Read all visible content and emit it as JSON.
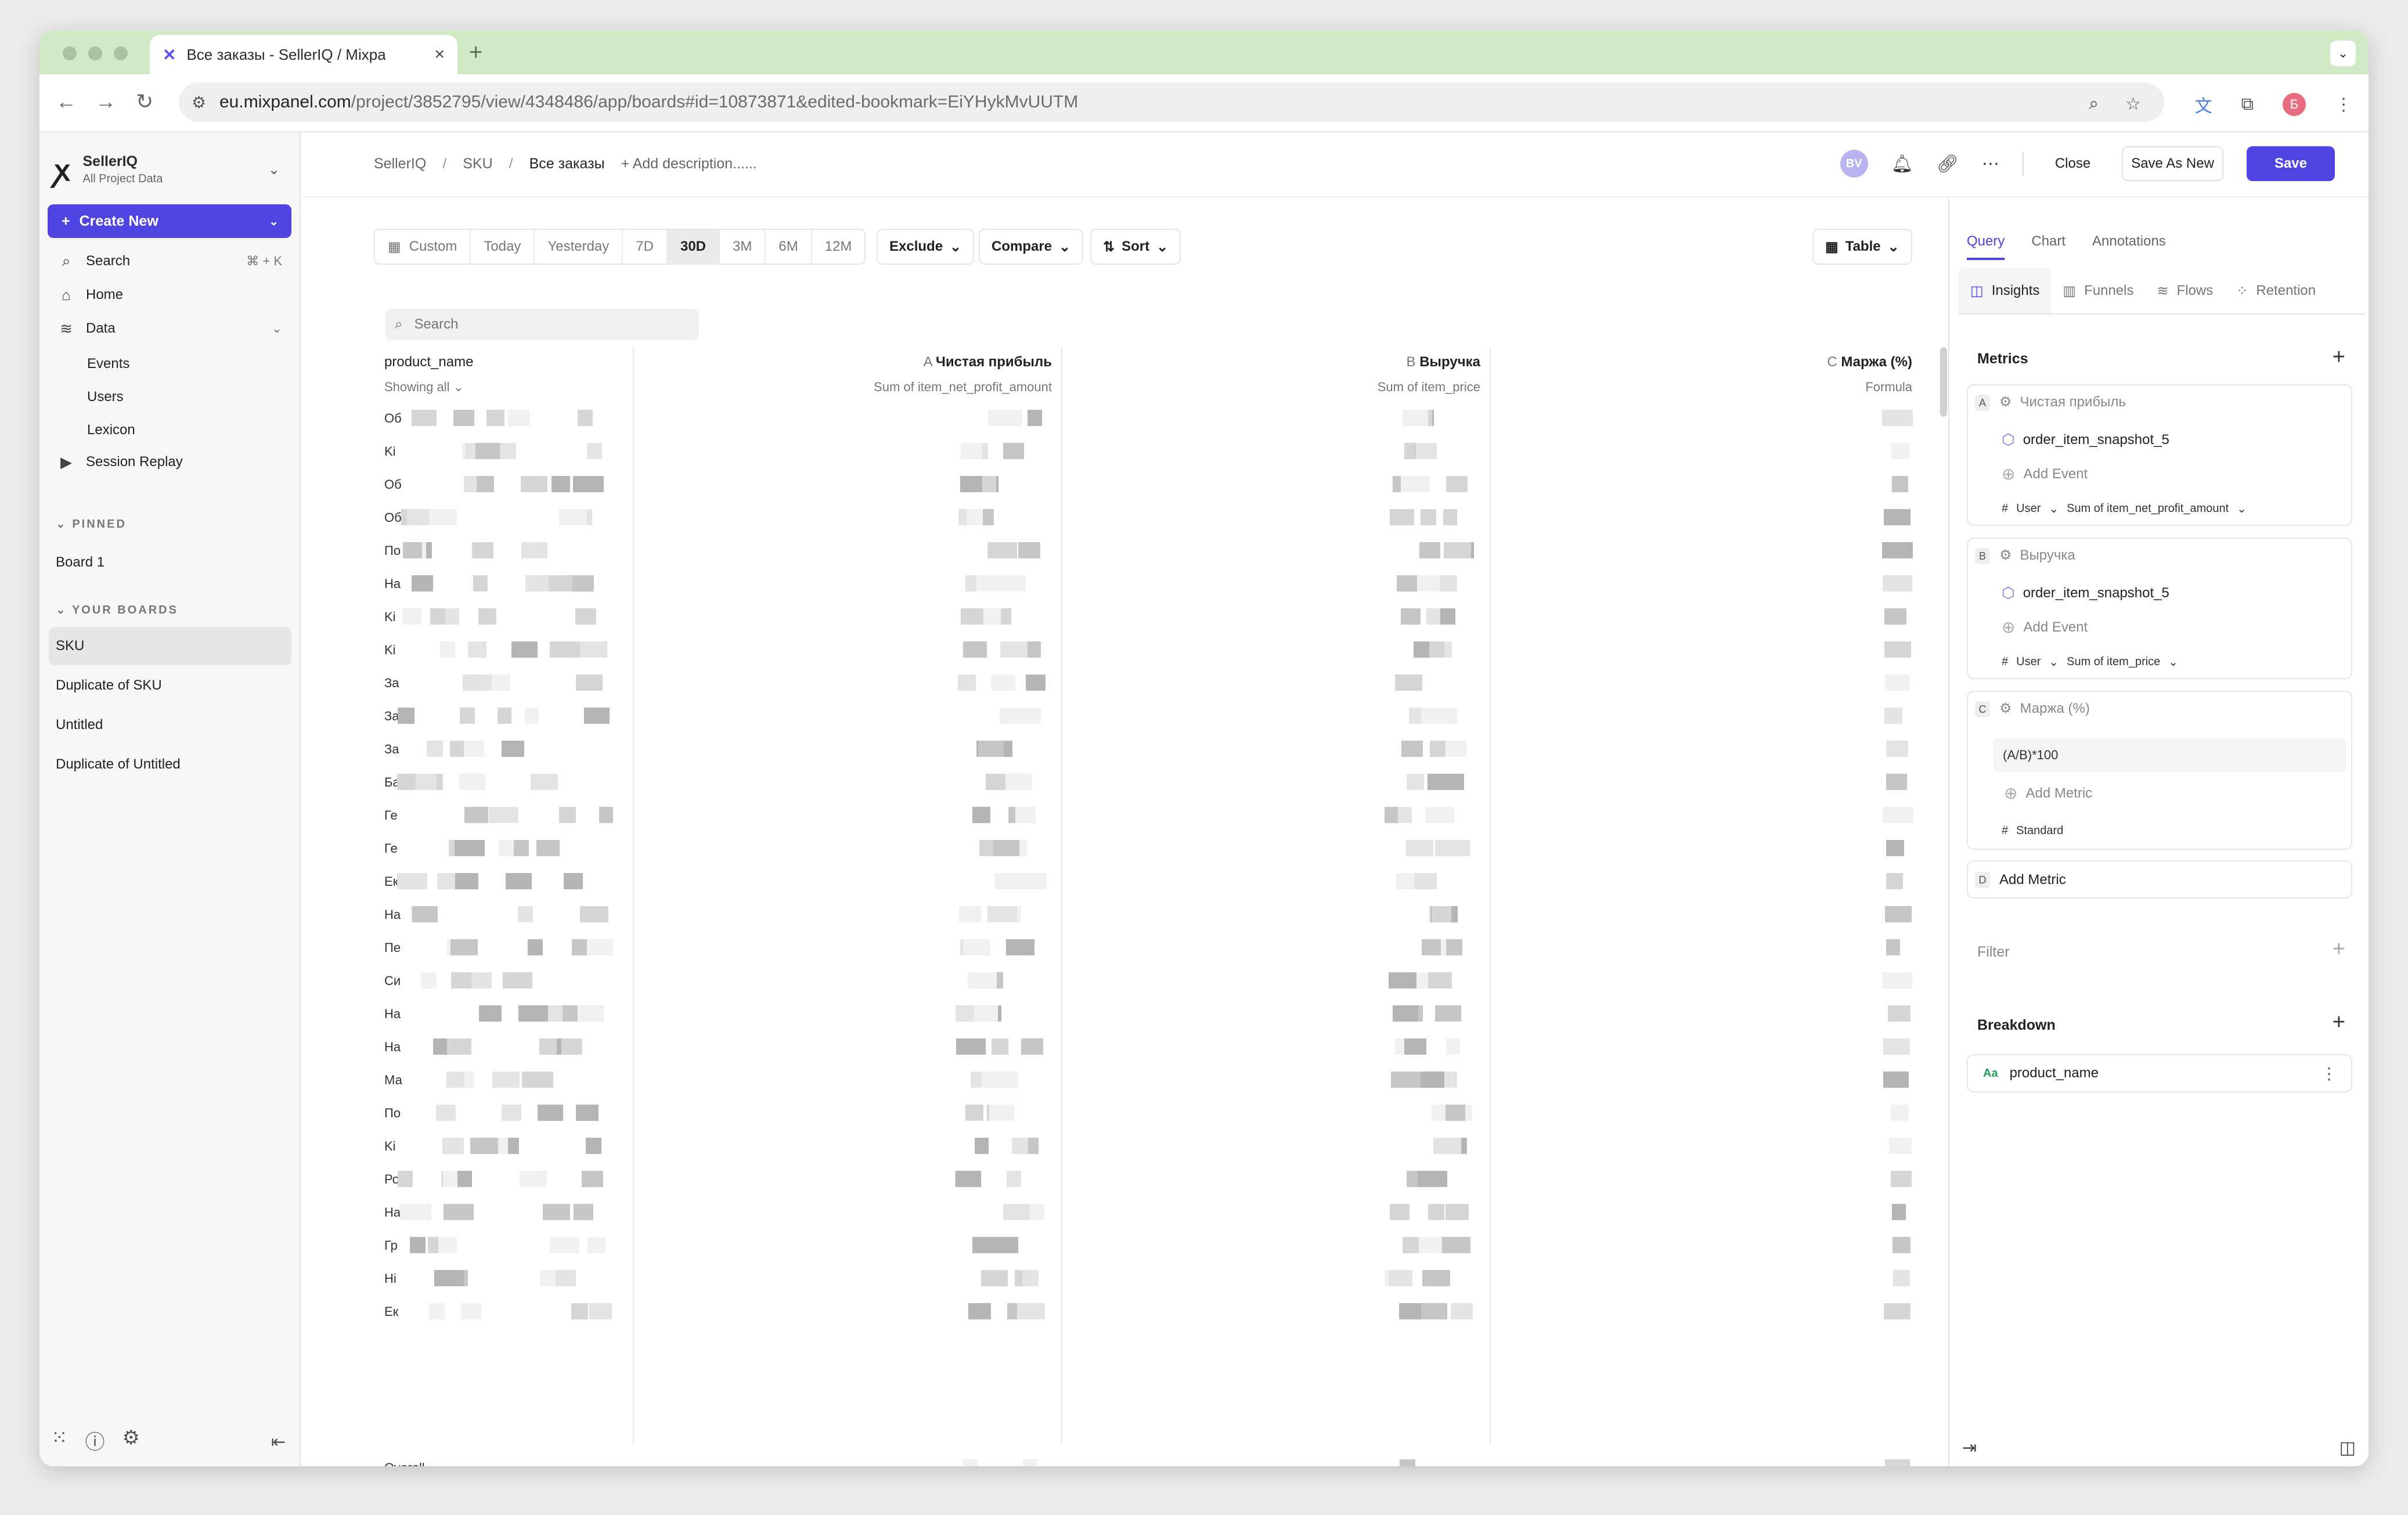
{
  "browser": {
    "tab_title": "Все заказы - SellerIQ / Mixpa",
    "url_host": "eu.mixpanel.com",
    "url_path": "/project/3852795/view/4348486/app/boards#id=10873871&edited-bookmark=EiYHykMvUUTM",
    "profile_initial": "Б"
  },
  "sidebar": {
    "org": "SellerIQ",
    "org_sub": "All Project Data",
    "create_label": "Create New",
    "search_label": "Search",
    "search_kbd": "⌘ + K",
    "home_label": "Home",
    "data_label": "Data",
    "data_items": [
      "Events",
      "Users",
      "Lexicon"
    ],
    "session_replay_label": "Session Replay",
    "pinned_label": "PINNED",
    "pinned": [
      "Board 1"
    ],
    "boards_label": "YOUR BOARDS",
    "boards": [
      "SKU",
      "Duplicate of SKU",
      "Untitled",
      "Duplicate of Untitled"
    ]
  },
  "header": {
    "breadcrumb": [
      "SellerIQ",
      "SKU",
      "Все заказы"
    ],
    "add_description": "+ Add description......",
    "avatar": "BV",
    "close_label": "Close",
    "save_as_new_label": "Save As New",
    "save_label": "Save"
  },
  "controls": {
    "date_ranges": [
      "Custom",
      "Today",
      "Yesterday",
      "7D",
      "30D",
      "3M",
      "6M",
      "12M"
    ],
    "active_range": "30D",
    "exclude_label": "Exclude",
    "compare_label": "Compare",
    "sort_label": "Sort",
    "view_label": "Table",
    "search_placeholder": "Search"
  },
  "table": {
    "col0": {
      "title": "product_name",
      "sub": "Showing all"
    },
    "col1": {
      "letter": "A",
      "title": "Чистая прибыль",
      "sub": "Sum of item_net_profit_amount"
    },
    "col2": {
      "letter": "B",
      "title": "Выручка",
      "sub": "Sum of item_price"
    },
    "col3": {
      "letter": "C",
      "title": "Маржа (%)",
      "sub": "Formula"
    },
    "rows": [
      "Об",
      "Ki",
      "Об",
      "Об",
      "По",
      "На",
      "Ki",
      "Ki",
      "За",
      "За",
      "За",
      "Ба",
      "Ге",
      "Ге",
      "Ек",
      "На",
      "Пе",
      "Си",
      "На",
      "На",
      "Ма",
      "По",
      "Ki",
      "Ро",
      "На",
      "Гр",
      "Hi",
      "Ек"
    ],
    "overall_label": "Overall"
  },
  "panel": {
    "tabs": [
      "Query",
      "Chart",
      "Annotations"
    ],
    "report_tabs": [
      "Insights",
      "Funnels",
      "Flows",
      "Retention"
    ],
    "metrics_label": "Metrics",
    "metrics": [
      {
        "letter": "A",
        "name": "Чистая прибыль",
        "event": "order_item_snapshot_5",
        "add": "Add Event",
        "scope": "User",
        "agg": "Sum of item_net_profit_amount"
      },
      {
        "letter": "B",
        "name": "Выручка",
        "event": "order_item_snapshot_5",
        "add": "Add Event",
        "scope": "User",
        "agg": "Sum of item_price"
      },
      {
        "letter": "C",
        "name": "Маржа (%)",
        "formula": "(A/B)*100",
        "add": "Add Metric",
        "format": "Standard"
      }
    ],
    "add_metric": {
      "letter": "D",
      "label": "Add Metric"
    },
    "filter_label": "Filter",
    "breakdown_label": "Breakdown",
    "breakdown_prop": "product_name",
    "breakdown_type": "Aa"
  }
}
